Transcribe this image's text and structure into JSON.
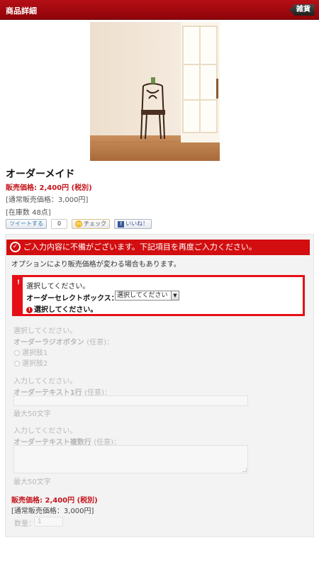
{
  "header": {
    "title": "商品詳細",
    "back_label": "雑貨"
  },
  "product": {
    "name": "オーダーメイド",
    "price": "販売価格: 2,400円 (税別)",
    "normal_price": "[通常販売価格：3,000円]",
    "stock": "[在庫数 48点]"
  },
  "social": {
    "tweet": "ツイートする",
    "tweet_count": "0",
    "mixi": "チェック",
    "facebook": "いいね！"
  },
  "form": {
    "error_message": "ご入力内容に不備がございます。下記項目を再度ご入力ください。",
    "option_note": "オプションにより販売価格が変わる場合もあります。",
    "select": {
      "flag": "!",
      "instruction": "選択してください。",
      "label": "オーダーセレクトボックス：",
      "value": "選択してください",
      "error": "選択してください。"
    },
    "radio": {
      "instruction": "選択してください。",
      "label": "オーダーラジオボタン",
      "optional": "(任意)：",
      "options": [
        "選択肢1",
        "選択肢2"
      ]
    },
    "text1": {
      "instruction": "入力してください。",
      "label": "オーダーテキスト1行",
      "optional": "(任意)：",
      "limit": "最大50文字"
    },
    "textarea": {
      "instruction": "入力してください。",
      "label": "オーダーテキスト複数行",
      "optional": "(任意)：",
      "limit": "最大50文字"
    },
    "price": "販売価格: 2,400円 (税別)",
    "normal_price": "[通常販売価格：3,000円]",
    "quantity_label": "数量：",
    "quantity_value": "1"
  },
  "colors": {
    "header": "#a50a11",
    "accent": "#c4141b",
    "error": "#d20e10"
  }
}
